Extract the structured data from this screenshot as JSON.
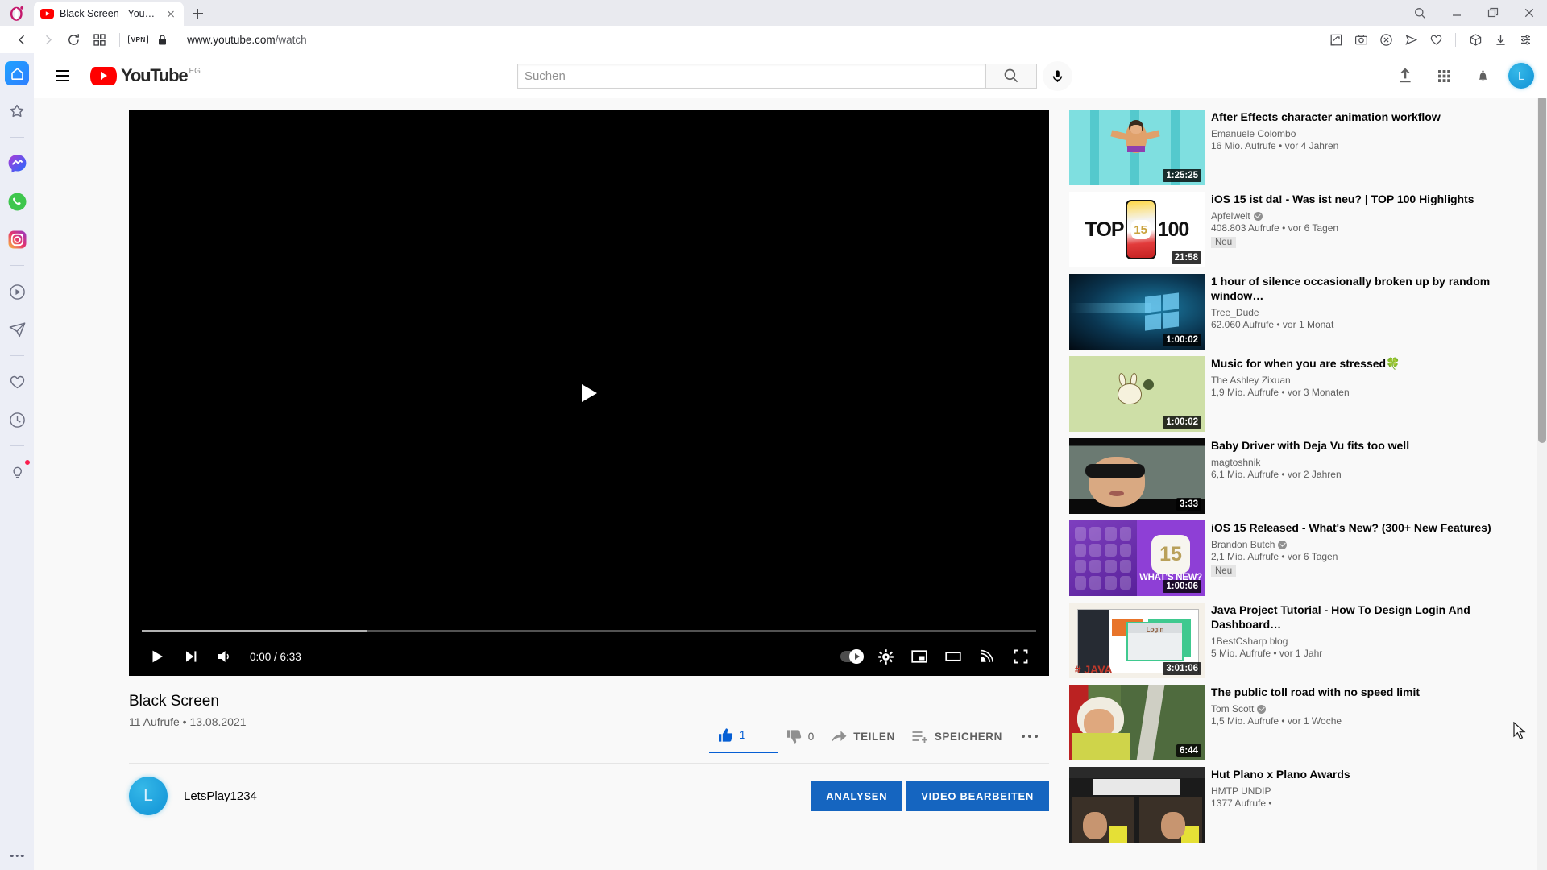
{
  "browser": {
    "name": "opera",
    "tab": {
      "title": "Black Screen - YouTube",
      "favicon": "youtube-icon"
    },
    "newtab_label": "+",
    "window_controls": [
      "search-icon",
      "minimize-icon",
      "restore-icon",
      "close-icon"
    ],
    "nav": {
      "back": "back-arrow-icon",
      "forward": "forward-arrow-icon",
      "reload": "reload-icon",
      "tiles": "tile-grid-icon",
      "vpn_badge": "VPN",
      "lock": "padlock-icon",
      "url_prefix": "www.youtube.com",
      "url_suffix": "/watch"
    },
    "toolbar_icons": [
      "snapshot-icon",
      "camera-icon",
      "adblock-shield-icon",
      "send-to-icon",
      "heart-icon",
      "crypto-wallet-icon",
      "downloads-icon",
      "easy-setup-icon"
    ],
    "sidebar": {
      "items": [
        {
          "name": "home",
          "icon": "home-icon",
          "active": true
        },
        {
          "name": "speed-dial",
          "icon": "star-icon",
          "active": false
        },
        {
          "name": "messenger",
          "icon": "messenger-icon",
          "active": false
        },
        {
          "name": "whatsapp",
          "icon": "whatsapp-icon",
          "active": false
        },
        {
          "name": "instagram",
          "icon": "instagram-icon",
          "active": false
        },
        {
          "name": "player",
          "icon": "play-circle-icon",
          "active": false
        },
        {
          "name": "telegram",
          "icon": "telegram-icon",
          "active": false
        },
        {
          "name": "favorites",
          "icon": "heart-outline-icon",
          "active": false
        },
        {
          "name": "history",
          "icon": "clock-icon",
          "active": false
        },
        {
          "name": "tips",
          "icon": "lightbulb-icon",
          "active": false,
          "badge": true
        }
      ],
      "more_label": "•••"
    }
  },
  "youtube": {
    "header": {
      "menu_icon": "hamburger-icon",
      "logo_text": "YouTube",
      "country_code": "EG",
      "search_placeholder": "Suchen",
      "search_value": "",
      "search_button_icon": "search-icon",
      "mic_icon": "microphone-icon",
      "upload_icon": "upload-icon",
      "apps_icon": "apps-grid-icon",
      "notifications_icon": "bell-icon",
      "avatar_initial": "L"
    },
    "player": {
      "play_overlay_icon": "play-icon",
      "play_icon": "play-icon",
      "next_icon": "next-track-icon",
      "volume_icon": "volume-icon",
      "time_display": "0:00 / 6:33",
      "current_time": "0:00",
      "duration": "6:33",
      "progress_percent": 0,
      "buffered_percent": 25,
      "autoplay_label": "autoplay-toggle",
      "autoplay_on": false,
      "settings_icon": "gear-icon",
      "miniplayer_icon": "miniplayer-icon",
      "theater_icon": "theater-mode-icon",
      "cast_icon": "cast-icon",
      "fullscreen_icon": "fullscreen-icon"
    },
    "video": {
      "title": "Black Screen",
      "meta": "11 Aufrufe • 13.08.2021",
      "views": "11 Aufrufe",
      "date": "13.08.2021",
      "like_count": "1",
      "dislike_count": "0",
      "share_label": "TEILEN",
      "save_label": "SPEICHERN",
      "more_label": "•••",
      "like_icon": "thumbs-up-icon",
      "dislike_icon": "thumbs-down-icon",
      "share_icon": "share-arrow-icon",
      "save_icon": "save-to-playlist-icon",
      "accent_color": "#065fd4"
    },
    "channel": {
      "avatar_initial": "L",
      "name": "LetsPlay1234",
      "analytics_label": "ANALYSEN",
      "edit_label": "VIDEO BEARBEITEN",
      "button_color": "#1565c0"
    },
    "related": [
      {
        "title": "After Effects character animation workflow",
        "channel": "Emanuele Colombo",
        "verified": false,
        "stats": "16 Mio. Aufrufe • vor 4 Jahren",
        "duration": "1:25:25",
        "badge": "",
        "thumb": "pool-swimmer"
      },
      {
        "title": "iOS 15 ist da! - Was ist neu? | TOP 100 Highlights",
        "channel": "Apfelwelt",
        "verified": true,
        "stats": "408.803 Aufrufe • vor 6 Tagen",
        "badge": "Neu",
        "duration": "21:58",
        "thumb": "top-100-iphone",
        "thumb_text": {
          "left": "TOP",
          "mid": "15",
          "right": "100"
        }
      },
      {
        "title": "1 hour of silence occasionally broken up by random window…",
        "channel": "Tree_Dude",
        "verified": false,
        "stats": "62.060 Aufrufe • vor 1 Monat",
        "duration": "1:00:02",
        "badge": "",
        "thumb": "windows-logo-dark"
      },
      {
        "title": "Music for when you are stressed🍀",
        "channel": "The Ashley Zixuan",
        "verified": false,
        "stats": "1,9 Mio. Aufrufe • vor 3 Monaten",
        "duration": "1:00:02",
        "badge": "",
        "thumb": "bunny-olive"
      },
      {
        "title": "Baby Driver with Deja Vu fits too well",
        "channel": "magtoshnik",
        "verified": false,
        "stats": "6,1 Mio. Aufrufe • vor 2 Jahren",
        "duration": "3:33",
        "badge": "",
        "thumb": "sunglasses-driver"
      },
      {
        "title": "iOS 15 Released - What's New? (300+ New Features)",
        "channel": "Brandon Butch",
        "verified": true,
        "stats": "2,1 Mio. Aufrufe • vor 6 Tagen",
        "badge": "Neu",
        "duration": "1:00:06",
        "thumb": "ios15-purple",
        "thumb_text": {
          "mid": "15",
          "caption": "WHAT'S NEW?"
        }
      },
      {
        "title": "Java Project Tutorial - How To Design Login And Dashboard…",
        "channel": "1BestCsharp blog",
        "verified": false,
        "stats": "5 Mio. Aufrufe • vor 1 Jahr",
        "duration": "3:01:06",
        "badge": "",
        "thumb": "java-login-dashboard",
        "thumb_text": {
          "caption": "# JAVA",
          "login": "Login"
        }
      },
      {
        "title": "The public toll road with no speed limit",
        "channel": "Tom Scott",
        "verified": true,
        "stats": "1,5 Mio. Aufrufe • vor 1 Woche",
        "duration": "6:44",
        "badge": "",
        "thumb": "toll-road-helmet"
      },
      {
        "title": "Hut Plano x Plano Awards",
        "channel": "HMTP UNDIP",
        "verified": false,
        "stats": "1377 Aufrufe • ",
        "duration": "",
        "badge": "",
        "thumb": "webinar-two-people"
      }
    ]
  }
}
